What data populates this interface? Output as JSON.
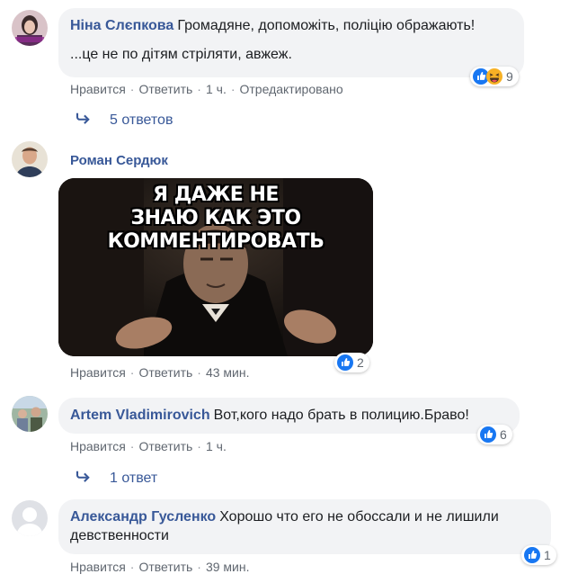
{
  "comments": [
    {
      "author": "Ніна Слєпкова",
      "text": "Громадяне, допоможіть, поліцію ображають!",
      "text2": "...це не по дітям стріляти, авжеж.",
      "like": "Нравится",
      "reply": "Ответить",
      "time": "1 ч.",
      "edited": "Отредактировано",
      "reaction_count": "9",
      "replies": "5 ответов"
    },
    {
      "author": "Роман Сердюк",
      "meme_line1": "Я ДАЖЕ НЕ",
      "meme_line2": "ЗНАЮ КАК ЭТО КОММЕНТИРОВАТЬ",
      "like": "Нравится",
      "reply": "Ответить",
      "time": "43 мин.",
      "reaction_count": "2"
    },
    {
      "author": "Artem Vladimirovich",
      "text": "Вот,кого надо брать в полицию.Браво!",
      "like": "Нравится",
      "reply": "Ответить",
      "time": "1 ч.",
      "reaction_count": "6",
      "replies": "1 ответ"
    },
    {
      "author": "Александр Гусленко",
      "text": "Хорошо что его не обоссали и не лишили",
      "text2": "девственности",
      "like": "Нравится",
      "reply": "Ответить",
      "time": "39 мин.",
      "reaction_count": "1"
    }
  ],
  "colors": {
    "author": "#385898",
    "bubble": "#f2f3f5",
    "meta": "#606770",
    "like_blue": "#1877f2",
    "haha_yellow": "#f7b125"
  },
  "icons": {
    "like": "thumbs-up-icon",
    "haha": "laughing-face-icon",
    "reply_arrow": "reply-arrow-icon"
  }
}
